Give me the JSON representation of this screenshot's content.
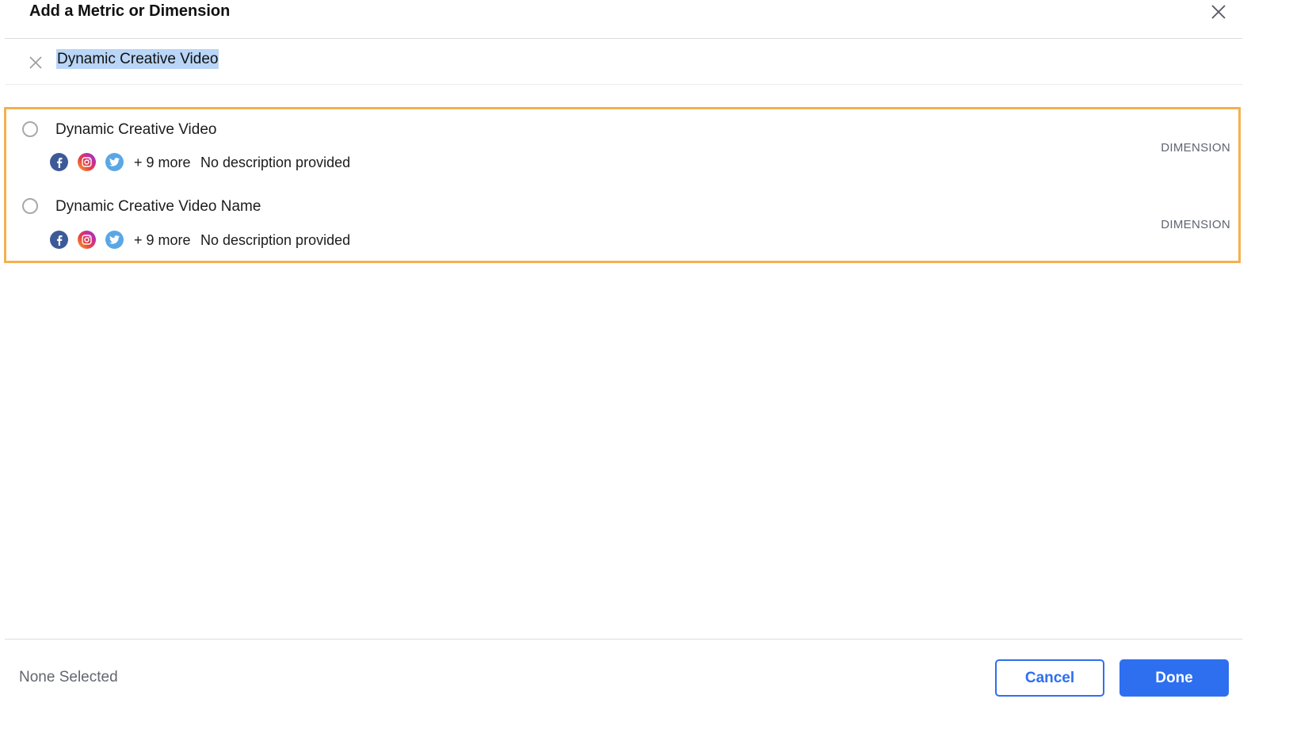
{
  "dialog": {
    "title": "Add a Metric or Dimension",
    "close_icon": "close-icon"
  },
  "search": {
    "value": "Dynamic Creative Video",
    "clear_icon": "clear-icon"
  },
  "results": [
    {
      "name": "Dynamic Creative Video",
      "channels": [
        "facebook-icon",
        "instagram-icon",
        "twitter-icon"
      ],
      "more": "+ 9 more",
      "description": "No description provided",
      "type": "DIMENSION",
      "selected": false
    },
    {
      "name": "Dynamic Creative Video Name",
      "channels": [
        "facebook-icon",
        "instagram-icon",
        "twitter-icon"
      ],
      "more": "+ 9 more",
      "description": "No description provided",
      "type": "DIMENSION",
      "selected": false
    }
  ],
  "footer": {
    "selection_status": "None Selected",
    "cancel_label": "Cancel",
    "done_label": "Done"
  },
  "colors": {
    "accent": "#2e6ff0",
    "highlight_border": "#f3b14f",
    "selection_bg": "#b9d5f7"
  }
}
